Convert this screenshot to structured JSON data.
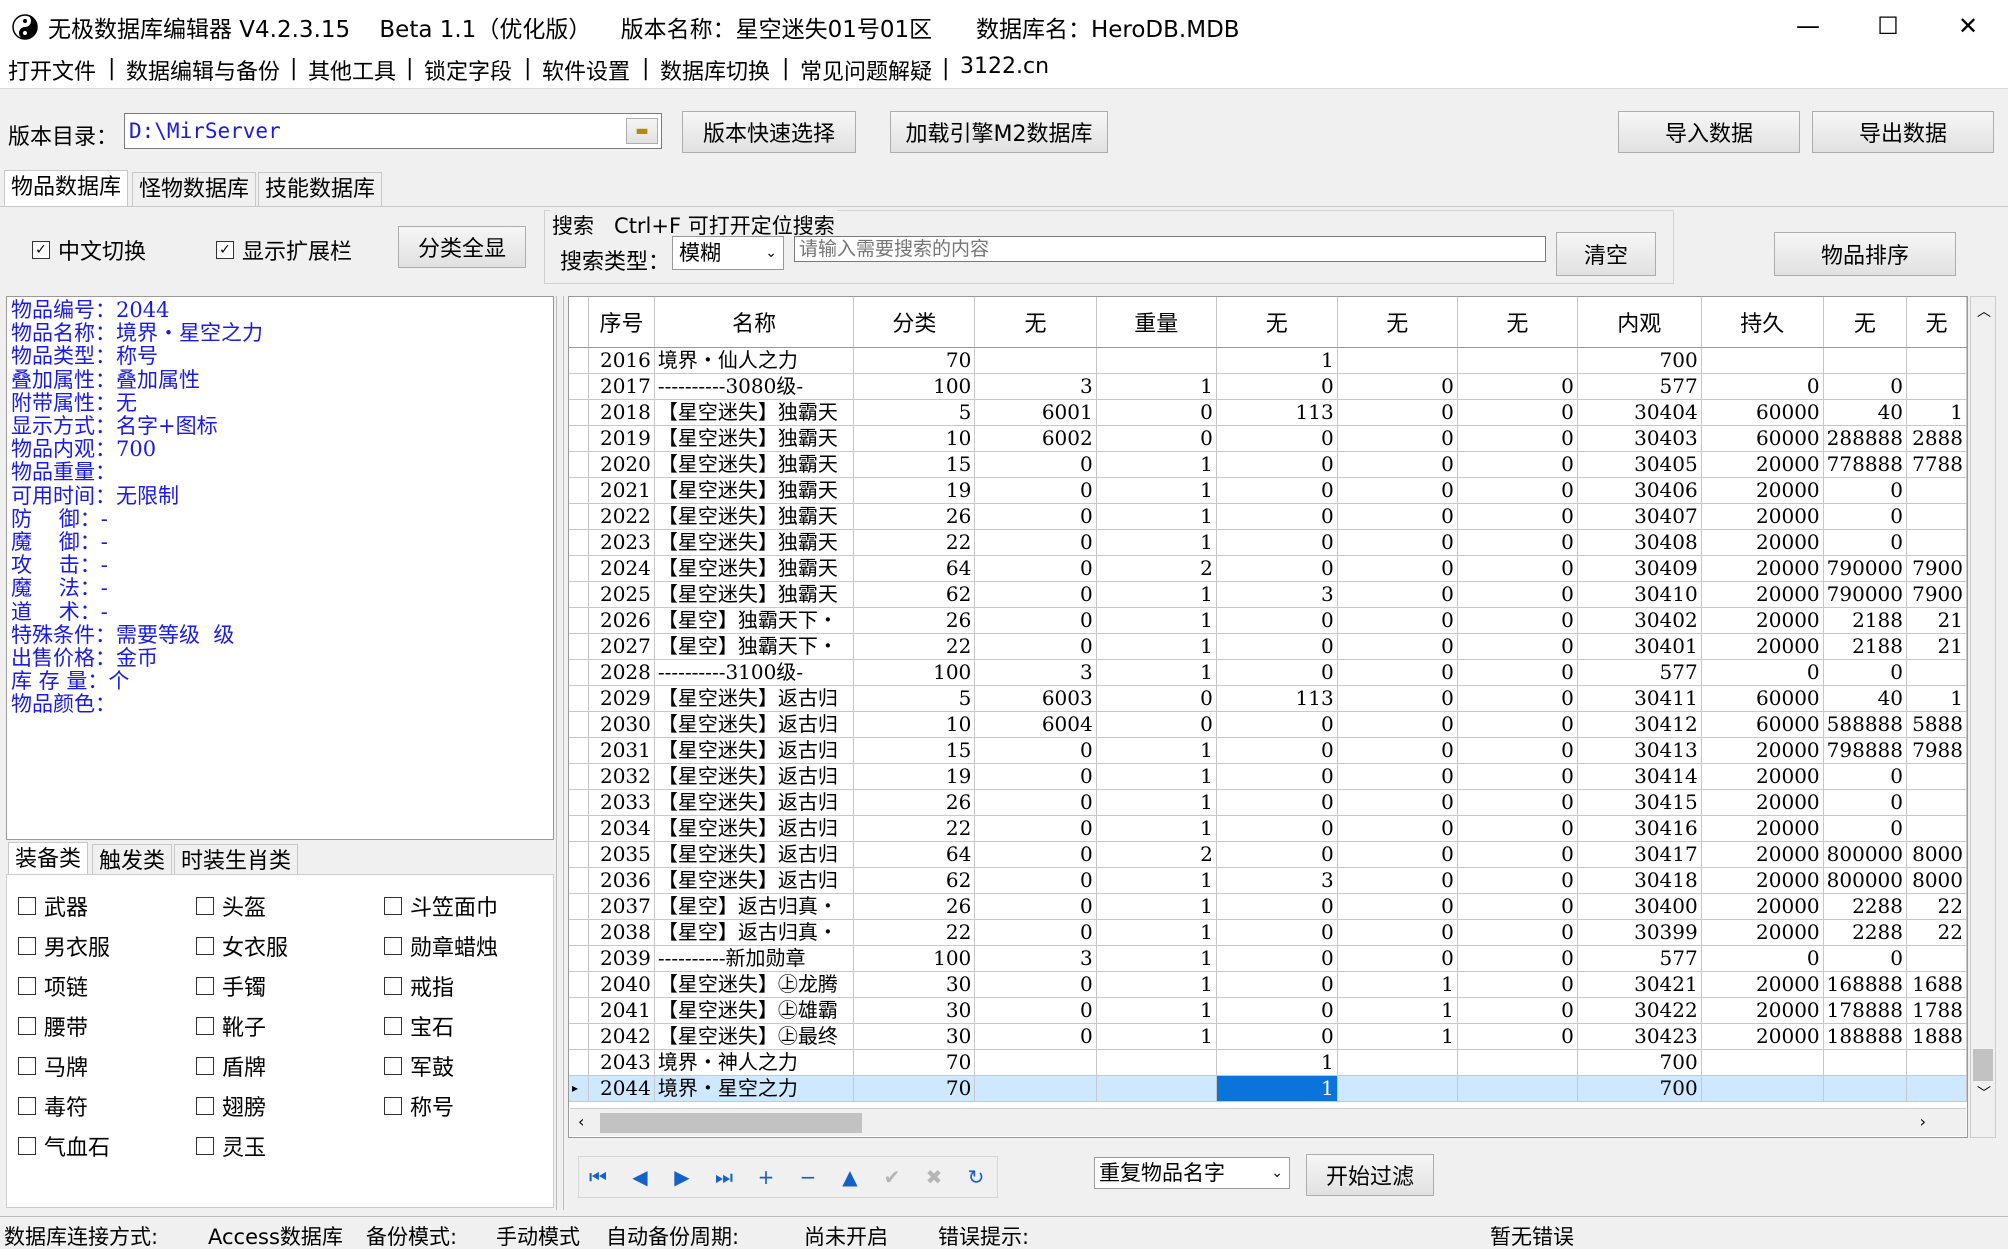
{
  "window": {
    "title": "无极数据库编辑器 V4.2.3.15    Beta 1.1（优化版）    版本名称：星空迷失01号01区      数据库名：HeroDB.MDB",
    "controls": [
      "—",
      "☐",
      "✕"
    ]
  },
  "menu": [
    "打开文件",
    "数据编辑与备份",
    "其他工具",
    "锁定字段",
    "软件设置",
    "数据库切换",
    "常见问题解疑",
    "3122.cn"
  ],
  "menu_separator": "|",
  "toolbar": {
    "dir_label": "版本目录：",
    "dir_value": "D:\\MirServer",
    "quick_select": "版本快速选择",
    "load_m2": "加载引擎M2数据库",
    "import": "导入数据",
    "export": "导出数据"
  },
  "db_tabs": [
    "物品数据库",
    "怪物数据库",
    "技能数据库"
  ],
  "options": {
    "cn_switch": "中文切换",
    "show_ext": "显示扩展栏",
    "show_all": "分类全显",
    "search_hint": "搜索   Ctrl+F 可打开定位搜索",
    "search_type_label": "搜索类型：",
    "search_type_value": "模糊",
    "search_placeholder": "请输入需要搜索的内容",
    "clear": "清空",
    "sort": "物品排序"
  },
  "info_lines": [
    "物品编号：2044",
    "物品名称：境界・星空之力",
    "物品类型：称号",
    "叠加属性：叠加属性",
    "附带属性：无",
    "显示方式：名字+图标",
    "物品内观：700",
    "物品重量：",
    "可用时间：无限制",
    "防    御：-",
    "魔    御：-",
    "攻    击：-",
    "魔    法：-",
    "道    术：-",
    "特殊条件：需要等级  级",
    "出售价格：金币",
    "库 存 量：个",
    "物品颜色："
  ],
  "category_tabs": [
    "装备类",
    "触发类",
    "时装生肖类"
  ],
  "categories": [
    [
      "武器",
      "头盔",
      "斗笠面巾"
    ],
    [
      "男衣服",
      "女衣服",
      "勋章蜡烛"
    ],
    [
      "项链",
      "手镯",
      "戒指"
    ],
    [
      "腰带",
      "靴子",
      "宝石"
    ],
    [
      "马牌",
      "盾牌",
      "军鼓"
    ],
    [
      "毒符",
      "翅膀",
      "称号"
    ],
    [
      "气血石",
      "灵玉",
      ""
    ]
  ],
  "grid": {
    "columns": [
      "序号",
      "名称",
      "分类",
      "无",
      "重量",
      "无",
      "无",
      "无",
      "内观",
      "持久",
      "无",
      "无"
    ],
    "rows": [
      [
        "2016",
        "境界・仙人之力",
        "70",
        "",
        "",
        "1",
        "",
        "",
        "700",
        "",
        "",
        ""
      ],
      [
        "2017",
        "----------3080级-",
        "100",
        "3",
        "1",
        "0",
        "0",
        "0",
        "577",
        "0",
        "0",
        ""
      ],
      [
        "2018",
        "【星空迷失】独霸天",
        "5",
        "6001",
        "0",
        "113",
        "0",
        "0",
        "30404",
        "60000",
        "40",
        "1"
      ],
      [
        "2019",
        "【星空迷失】独霸天",
        "10",
        "6002",
        "0",
        "0",
        "0",
        "0",
        "30403",
        "60000",
        "288888",
        "2888"
      ],
      [
        "2020",
        "【星空迷失】独霸天",
        "15",
        "0",
        "1",
        "0",
        "0",
        "0",
        "30405",
        "20000",
        "778888",
        "7788"
      ],
      [
        "2021",
        "【星空迷失】独霸天",
        "19",
        "0",
        "1",
        "0",
        "0",
        "0",
        "30406",
        "20000",
        "0",
        ""
      ],
      [
        "2022",
        "【星空迷失】独霸天",
        "26",
        "0",
        "1",
        "0",
        "0",
        "0",
        "30407",
        "20000",
        "0",
        ""
      ],
      [
        "2023",
        "【星空迷失】独霸天",
        "22",
        "0",
        "1",
        "0",
        "0",
        "0",
        "30408",
        "20000",
        "0",
        ""
      ],
      [
        "2024",
        "【星空迷失】独霸天",
        "64",
        "0",
        "2",
        "0",
        "0",
        "0",
        "30409",
        "20000",
        "790000",
        "7900"
      ],
      [
        "2025",
        "【星空迷失】独霸天",
        "62",
        "0",
        "1",
        "3",
        "0",
        "0",
        "30410",
        "20000",
        "790000",
        "7900"
      ],
      [
        "2026",
        "【星空】独霸天下・",
        "26",
        "0",
        "1",
        "0",
        "0",
        "0",
        "30402",
        "20000",
        "2188",
        "21"
      ],
      [
        "2027",
        "【星空】独霸天下・",
        "22",
        "0",
        "1",
        "0",
        "0",
        "0",
        "30401",
        "20000",
        "2188",
        "21"
      ],
      [
        "2028",
        "----------3100级-",
        "100",
        "3",
        "1",
        "0",
        "0",
        "0",
        "577",
        "0",
        "0",
        ""
      ],
      [
        "2029",
        "【星空迷失】返古归",
        "5",
        "6003",
        "0",
        "113",
        "0",
        "0",
        "30411",
        "60000",
        "40",
        "1"
      ],
      [
        "2030",
        "【星空迷失】返古归",
        "10",
        "6004",
        "0",
        "0",
        "0",
        "0",
        "30412",
        "60000",
        "588888",
        "5888"
      ],
      [
        "2031",
        "【星空迷失】返古归",
        "15",
        "0",
        "1",
        "0",
        "0",
        "0",
        "30413",
        "20000",
        "798888",
        "7988"
      ],
      [
        "2032",
        "【星空迷失】返古归",
        "19",
        "0",
        "1",
        "0",
        "0",
        "0",
        "30414",
        "20000",
        "0",
        ""
      ],
      [
        "2033",
        "【星空迷失】返古归",
        "26",
        "0",
        "1",
        "0",
        "0",
        "0",
        "30415",
        "20000",
        "0",
        ""
      ],
      [
        "2034",
        "【星空迷失】返古归",
        "22",
        "0",
        "1",
        "0",
        "0",
        "0",
        "30416",
        "20000",
        "0",
        ""
      ],
      [
        "2035",
        "【星空迷失】返古归",
        "64",
        "0",
        "2",
        "0",
        "0",
        "0",
        "30417",
        "20000",
        "800000",
        "8000"
      ],
      [
        "2036",
        "【星空迷失】返古归",
        "62",
        "0",
        "1",
        "3",
        "0",
        "0",
        "30418",
        "20000",
        "800000",
        "8000"
      ],
      [
        "2037",
        "【星空】返古归真・",
        "26",
        "0",
        "1",
        "0",
        "0",
        "0",
        "30400",
        "20000",
        "2288",
        "22"
      ],
      [
        "2038",
        "【星空】返古归真・",
        "22",
        "0",
        "1",
        "0",
        "0",
        "0",
        "30399",
        "20000",
        "2288",
        "22"
      ],
      [
        "2039",
        "----------新加勋章",
        "100",
        "3",
        "1",
        "0",
        "0",
        "0",
        "577",
        "0",
        "0",
        ""
      ],
      [
        "2040",
        "【星空迷失】㊤龙腾",
        "30",
        "0",
        "1",
        "0",
        "1",
        "0",
        "30421",
        "20000",
        "168888",
        "1688"
      ],
      [
        "2041",
        "【星空迷失】㊤雄霸",
        "30",
        "0",
        "1",
        "0",
        "1",
        "0",
        "30422",
        "20000",
        "178888",
        "1788"
      ],
      [
        "2042",
        "【星空迷失】㊤最终",
        "30",
        "0",
        "1",
        "0",
        "1",
        "0",
        "30423",
        "20000",
        "188888",
        "1888"
      ],
      [
        "2043",
        "境界・神人之力",
        "70",
        "",
        "",
        "1",
        "",
        "",
        "700",
        "",
        "",
        ""
      ],
      [
        "2044",
        "境界・星空之力",
        "70",
        "",
        "",
        "1",
        "",
        "",
        "700",
        "",
        "",
        ""
      ]
    ],
    "selected_row": 28
  },
  "filter": {
    "select_value": "重复物品名字",
    "start": "开始过滤"
  },
  "nav_icons": [
    "first-icon",
    "prior-icon",
    "next-icon",
    "last-icon",
    "insert-icon",
    "delete-icon",
    "edit-icon",
    "post-icon",
    "cancel-icon",
    "refresh-icon"
  ],
  "status": {
    "conn_label": "数据库连接方式:",
    "conn_value": "Access数据库",
    "backup_label": "备份模式:",
    "backup_value": "手动模式",
    "auto_label": "自动备份周期:",
    "auto_value": "尚未开启",
    "error_label": "错误提示:",
    "error_value": "暂无错误"
  }
}
